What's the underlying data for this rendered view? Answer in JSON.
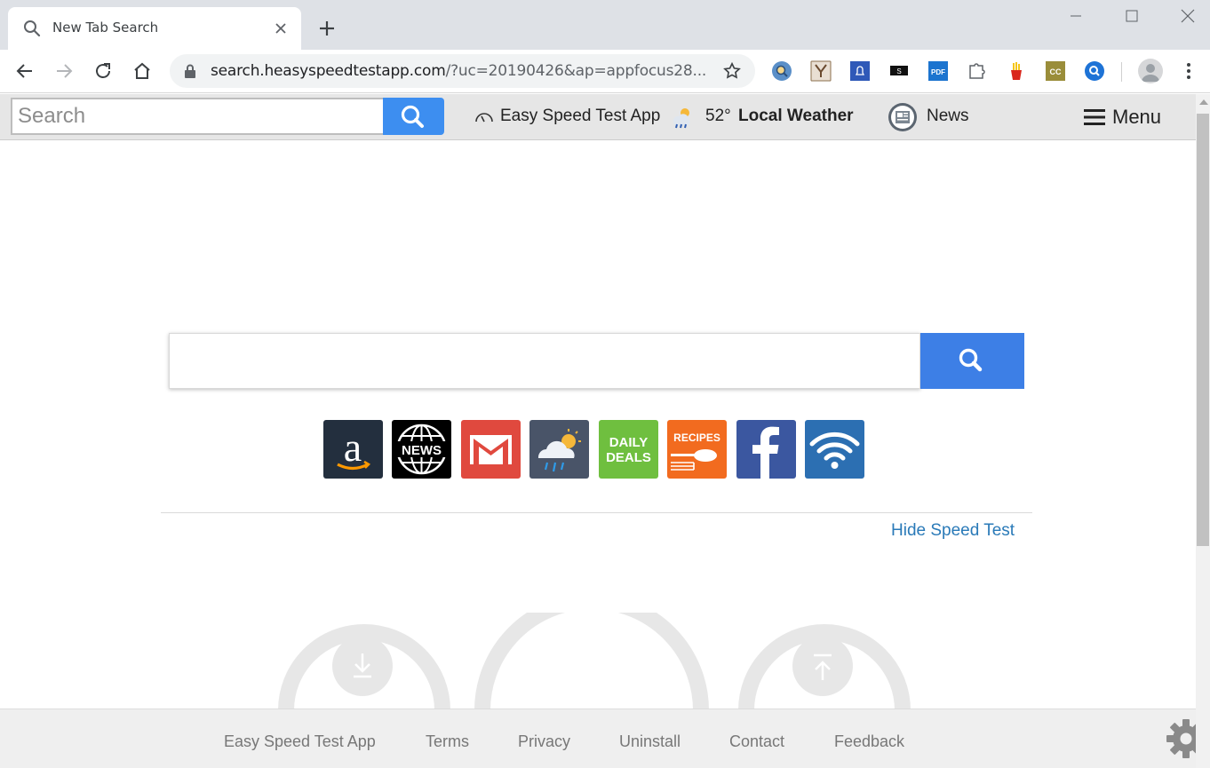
{
  "browser": {
    "tab": {
      "title": "New Tab Search"
    },
    "url": {
      "host": "search.heasyspeedtestapp.com",
      "path": "/?uc=20190426&ap=appfocus28..."
    }
  },
  "pagebar": {
    "search_placeholder": "Search",
    "speed_link": "Easy Speed Test App",
    "temperature": "52°",
    "weather_link": "Local Weather",
    "news_link": "News",
    "menu_label": "Menu"
  },
  "main": {
    "search_placeholder": "",
    "tiles": [
      "Amazon",
      "News",
      "Gmail",
      "Weather",
      "Daily Deals",
      "Recipes",
      "Facebook",
      "WiFi"
    ],
    "tile_text": {
      "news": "NEWS",
      "deals_line1": "DAILY",
      "deals_line2": "DEALS",
      "recipes": "RECIPES"
    },
    "hide_link": "Hide Speed Test"
  },
  "footer": {
    "links": [
      "Easy Speed Test App",
      "Terms",
      "Privacy",
      "Uninstall",
      "Contact",
      "Feedback"
    ]
  },
  "colors": {
    "accent_blue": "#3d7fe6",
    "link_blue": "#2a7ab8",
    "gmail_red": "#e0493e",
    "deals_green": "#6fbf3f",
    "recipes_orange": "#f26b1f",
    "facebook_blue": "#3b57a0",
    "wifi_blue": "#2c6fb2"
  }
}
